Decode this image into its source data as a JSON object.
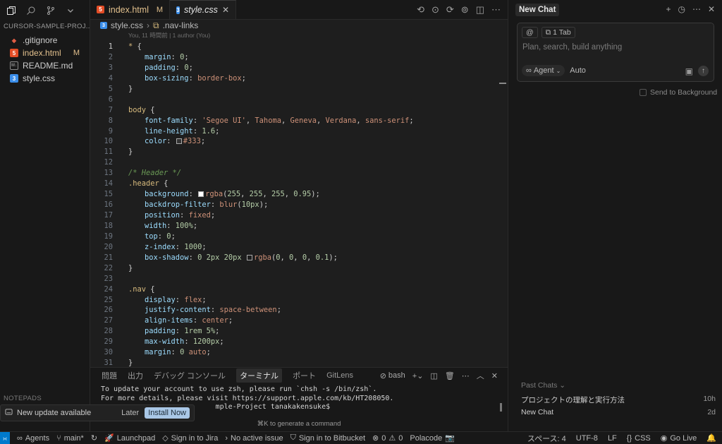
{
  "sidebar": {
    "explorer_title": "CURSOR-SAMPLE-PROJ...",
    "files": [
      {
        "name": ".gitignore",
        "icon": "git-icon",
        "icon_color": "#e05d44",
        "modified": ""
      },
      {
        "name": "index.html",
        "icon": "html-icon",
        "icon_color": "#e44d26",
        "modified": "M"
      },
      {
        "name": "README.md",
        "icon": "markdown-icon",
        "icon_color": "#8a8a8a",
        "modified": ""
      },
      {
        "name": "style.css",
        "icon": "css-icon",
        "icon_color": "#3b8eea",
        "modified": ""
      }
    ],
    "notepads": "NOTEPADS"
  },
  "update_toast": {
    "message": "New update available",
    "later": "Later",
    "install": "Install Now"
  },
  "editor": {
    "tabs": [
      {
        "label": "index.html",
        "badge": "M"
      },
      {
        "label": "style.css",
        "close": "✕"
      }
    ],
    "breadcrumb": {
      "file": "style.css",
      "symbol": ".nav-links"
    },
    "blame": "You, 11 時間前 | 1 author (You)"
  },
  "panel": {
    "tabs": [
      "問題",
      "出力",
      "デバッグ コンソール",
      "ターミナル",
      "ポート",
      "GitLens"
    ],
    "active_tab": "ターミナル",
    "shell": "bash",
    "terminal_lines": [
      "To update your account to use zsh, please run `chsh -s /bin/zsh`.",
      "For more details, please visit https://support.apple.com/kb/HT208050.",
      "                           mple-Project tanakakensuke$"
    ],
    "cmd_hint": "⌘K to generate a command"
  },
  "chat": {
    "title": "New Chat",
    "context_chip_at": "@",
    "context_chip_tab": "1 Tab",
    "placeholder": "Plan, search, build anything",
    "mode": "Agent",
    "model": "Auto",
    "send_background": "Send to Background",
    "past_title": "Past Chats",
    "past": [
      {
        "title": "プロジェクトの理解と実行方法",
        "age": "10h"
      },
      {
        "title": "New Chat",
        "age": "2d"
      }
    ]
  },
  "statusbar": {
    "agents": "Agents",
    "branch": "main*",
    "launchpad": "Launchpad",
    "jira": "Sign in to Jira",
    "issue": "No active issue",
    "bitbucket": "Sign in to Bitbucket",
    "errors": "0",
    "warnings": "0",
    "polacode": "Polacode",
    "spaces": "スペース: 4",
    "encoding": "UTF-8",
    "eol": "LF",
    "language": "CSS",
    "golive": "Go Live"
  }
}
